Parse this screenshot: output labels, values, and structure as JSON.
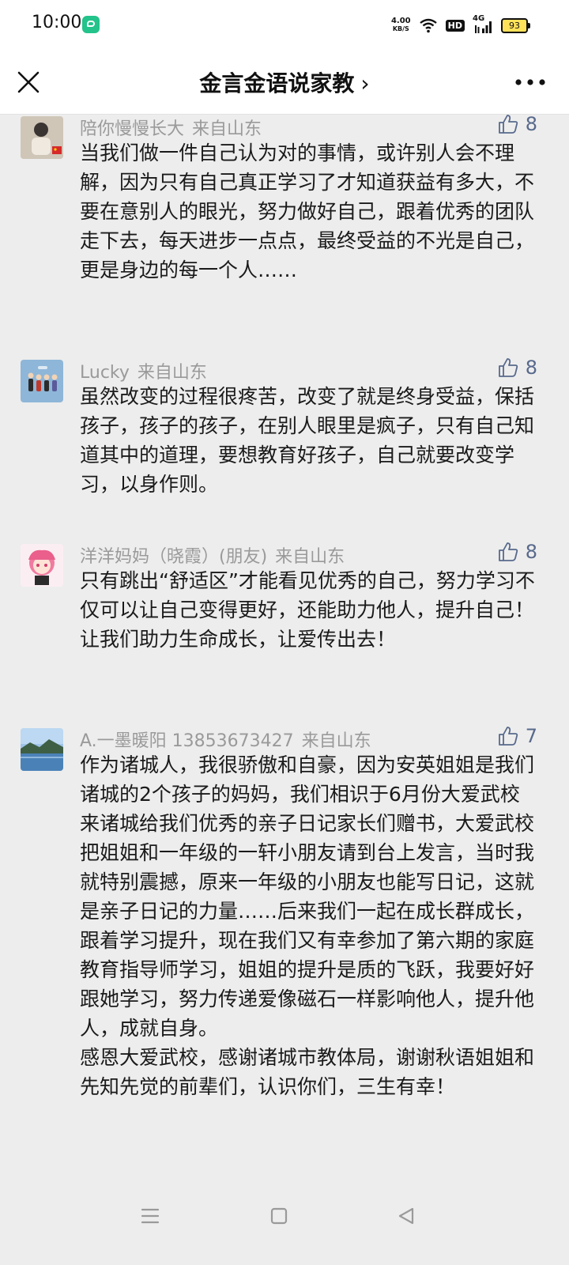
{
  "status_bar": {
    "time": "10:00",
    "net_speed_value": "4.00",
    "net_speed_unit": "KB/S",
    "hd": "HD",
    "network": "4G",
    "battery": "93"
  },
  "nav": {
    "title": "金言金语说家教",
    "chevron": "›",
    "close_icon": "close-icon",
    "more_icon": "more-icon"
  },
  "comments": [
    {
      "user": "陪你慢慢长大",
      "location": "来自山东",
      "likes": "8",
      "text": "当我们做一件自己认为对的事情，或许别人会不理解，因为只有自己真正学习了才知道获益有多大，不要在意别人的眼光，努力做好自己，跟着优秀的团队走下去，每天进步一点点，最终受益的不光是自己，更是身边的每一个人……"
    },
    {
      "user": "Lucky",
      "location": "来自山东",
      "likes": "8",
      "text": "虽然改变的过程很疼苦，改变了就是终身受益，保括孩子，孩子的孩子，在别人眼里是疯子，只有自己知道其中的道理，要想教育好孩子，自己就要改变学习，以身作则。"
    },
    {
      "user": "洋洋妈妈（晓霞）(朋友)",
      "location": "来自山东",
      "likes": "8",
      "text": "只有跳出“舒适区”才能看见优秀的自己，努力学习不仅可以让自己变得更好，还能助力他人，提升自己！让我们助力生命成长，让爱传出去！"
    },
    {
      "user": "A.一墨暖阳 13853673427",
      "location": "来自山东",
      "likes": "7",
      "text": "作为诸城人，我很骄傲和自豪，因为安英姐姐是我们诸城的2个孩子的妈妈，我们相识于6月份大爱武校来诸城给我们优秀的亲子日记家长们赠书，大爱武校把姐姐和一年级的一轩小朋友请到台上发言，当时我就特别震撼，原来一年级的小朋友也能写日记，这就是亲子日记的力量……后来我们一起在成长群成长，跟着学习提升，现在我们又有幸参加了第六期的家庭教育指导师学习，姐姐的提升是质的飞跃，我要好好跟她学习，努力传递爱像磁石一样影响他人，提升他人，成就自身。\n感恩大爱武校，感谢诸城市教体局，谢谢秋语姐姐和先知先觉的前辈们，认识你们，三生有幸！"
    }
  ],
  "system_nav": {
    "menu_icon": "menu-icon",
    "home_icon": "home-icon",
    "back_icon": "back-icon"
  }
}
